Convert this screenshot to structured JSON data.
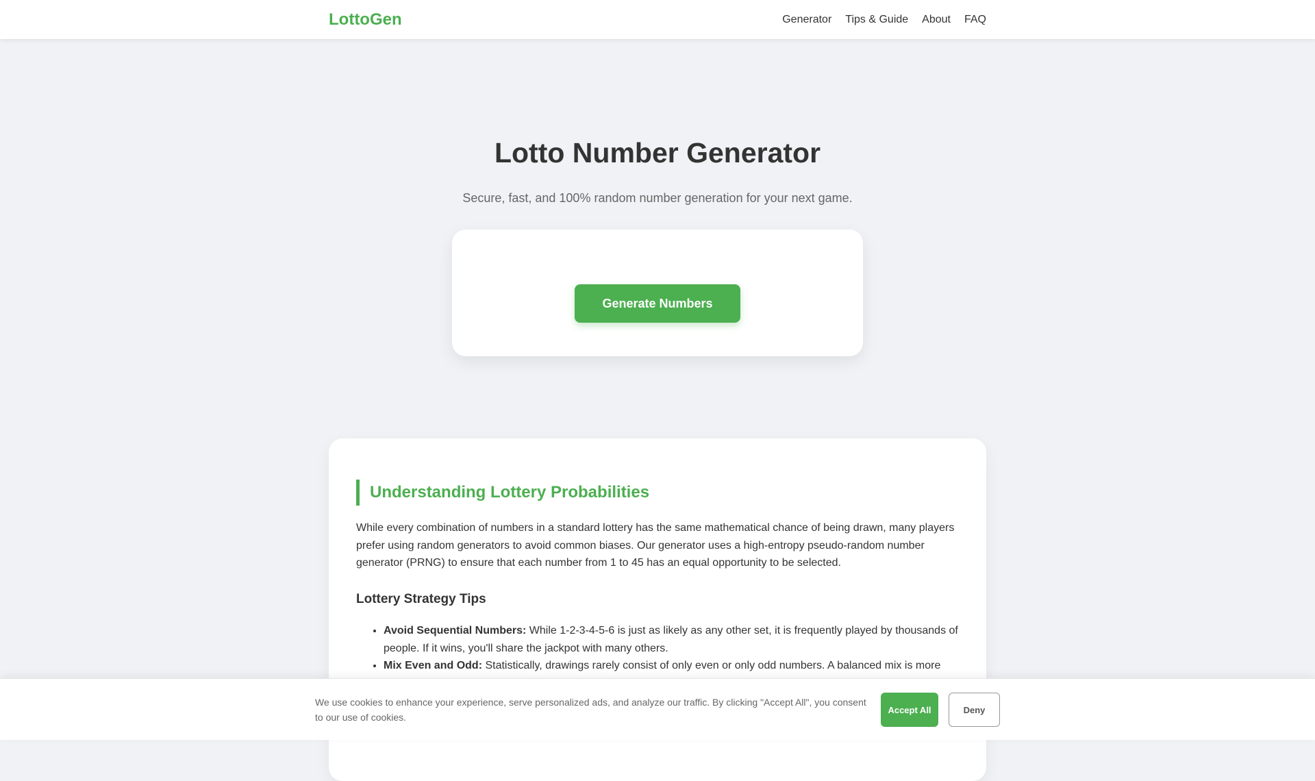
{
  "header": {
    "logo": "LottoGen",
    "nav": [
      "Generator",
      "Tips & Guide",
      "About",
      "FAQ"
    ]
  },
  "hero": {
    "title": "Lotto Number Generator",
    "subtitle": "Secure, fast, and 100% random number generation for your next game.",
    "generate_label": "Generate Numbers"
  },
  "content": {
    "section_title": "Understanding Lottery Probabilities",
    "paragraph": "While every combination of numbers in a standard lottery has the same mathematical chance of being drawn, many players prefer using random generators to avoid common biases. Our generator uses a high-entropy pseudo-random number generator (PRNG) to ensure that each number from 1 to 45 has an equal opportunity to be selected.",
    "tips_title": "Lottery Strategy Tips",
    "tips": [
      {
        "label": "Avoid Sequential Numbers:",
        "text": " While 1-2-3-4-5-6 is just as likely as any other set, it is frequently played by thousands of people. If it wins, you'll share the jackpot with many others."
      },
      {
        "label": "Mix Even and Odd:",
        "text": " Statistically, drawings rarely consist of only even or only odd numbers. A balanced mix is more"
      }
    ]
  },
  "cookie": {
    "text": "We use cookies to enhance your experience, serve personalized ads, and analyze our traffic. By clicking \"Accept All\", you consent to our use of cookies.",
    "accept_label": "Accept All",
    "deny_label": "Deny"
  },
  "colors": {
    "accent": "#4caf50",
    "background": "#f0f2f5",
    "text": "#333333"
  }
}
